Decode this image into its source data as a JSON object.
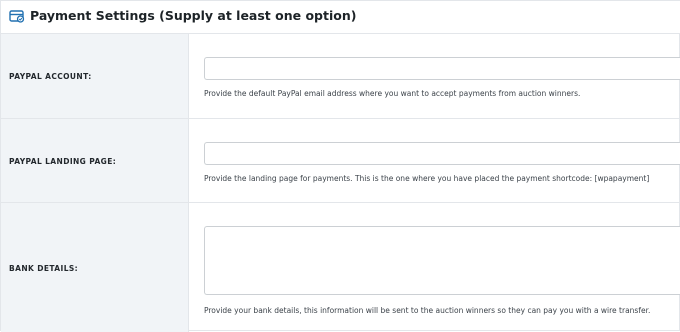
{
  "header": {
    "title": "Payment Settings (Supply at least one option)",
    "icon": "payment-card-icon",
    "icon_color": "#2271b1"
  },
  "fields": {
    "paypal_account": {
      "label": "PAYPAL ACCOUNT:",
      "value": "",
      "description": "Provide the default PayPal email address where you want to accept payments from auction winners."
    },
    "paypal_landing_page": {
      "label": "PAYPAL LANDING PAGE:",
      "value": "",
      "description": "Provide the landing page for payments. This is the one where you have placed the payment shortcode: [wpapayment]"
    },
    "bank_details": {
      "label": "BANK DETAILS:",
      "value": "",
      "description": "Provide your bank details, this information will be sent to the auction winners so they can pay you with a wire transfer."
    }
  }
}
